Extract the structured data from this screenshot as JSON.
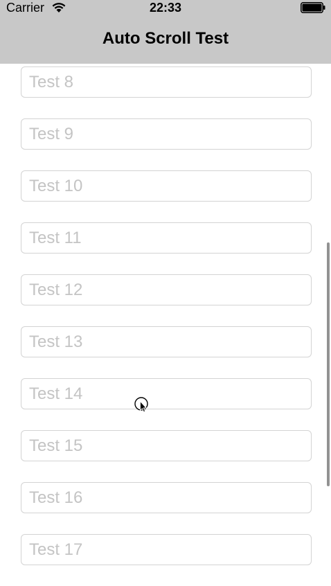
{
  "status_bar": {
    "carrier": "Carrier",
    "time": "22:33",
    "wifi_icon": "wifi-icon",
    "battery_icon": "battery-icon"
  },
  "nav": {
    "title": "Auto Scroll Test"
  },
  "fields": [
    {
      "placeholder": "Test 8",
      "value": ""
    },
    {
      "placeholder": "Test 9",
      "value": ""
    },
    {
      "placeholder": "Test 10",
      "value": ""
    },
    {
      "placeholder": "Test 11",
      "value": ""
    },
    {
      "placeholder": "Test 12",
      "value": ""
    },
    {
      "placeholder": "Test 13",
      "value": ""
    },
    {
      "placeholder": "Test 14",
      "value": ""
    },
    {
      "placeholder": "Test 15",
      "value": ""
    },
    {
      "placeholder": "Test 16",
      "value": ""
    },
    {
      "placeholder": "Test 17",
      "value": ""
    }
  ],
  "colors": {
    "nav_background": "#c8c8c8",
    "placeholder": "#c4c4c4",
    "field_border": "#d3d3d3"
  }
}
